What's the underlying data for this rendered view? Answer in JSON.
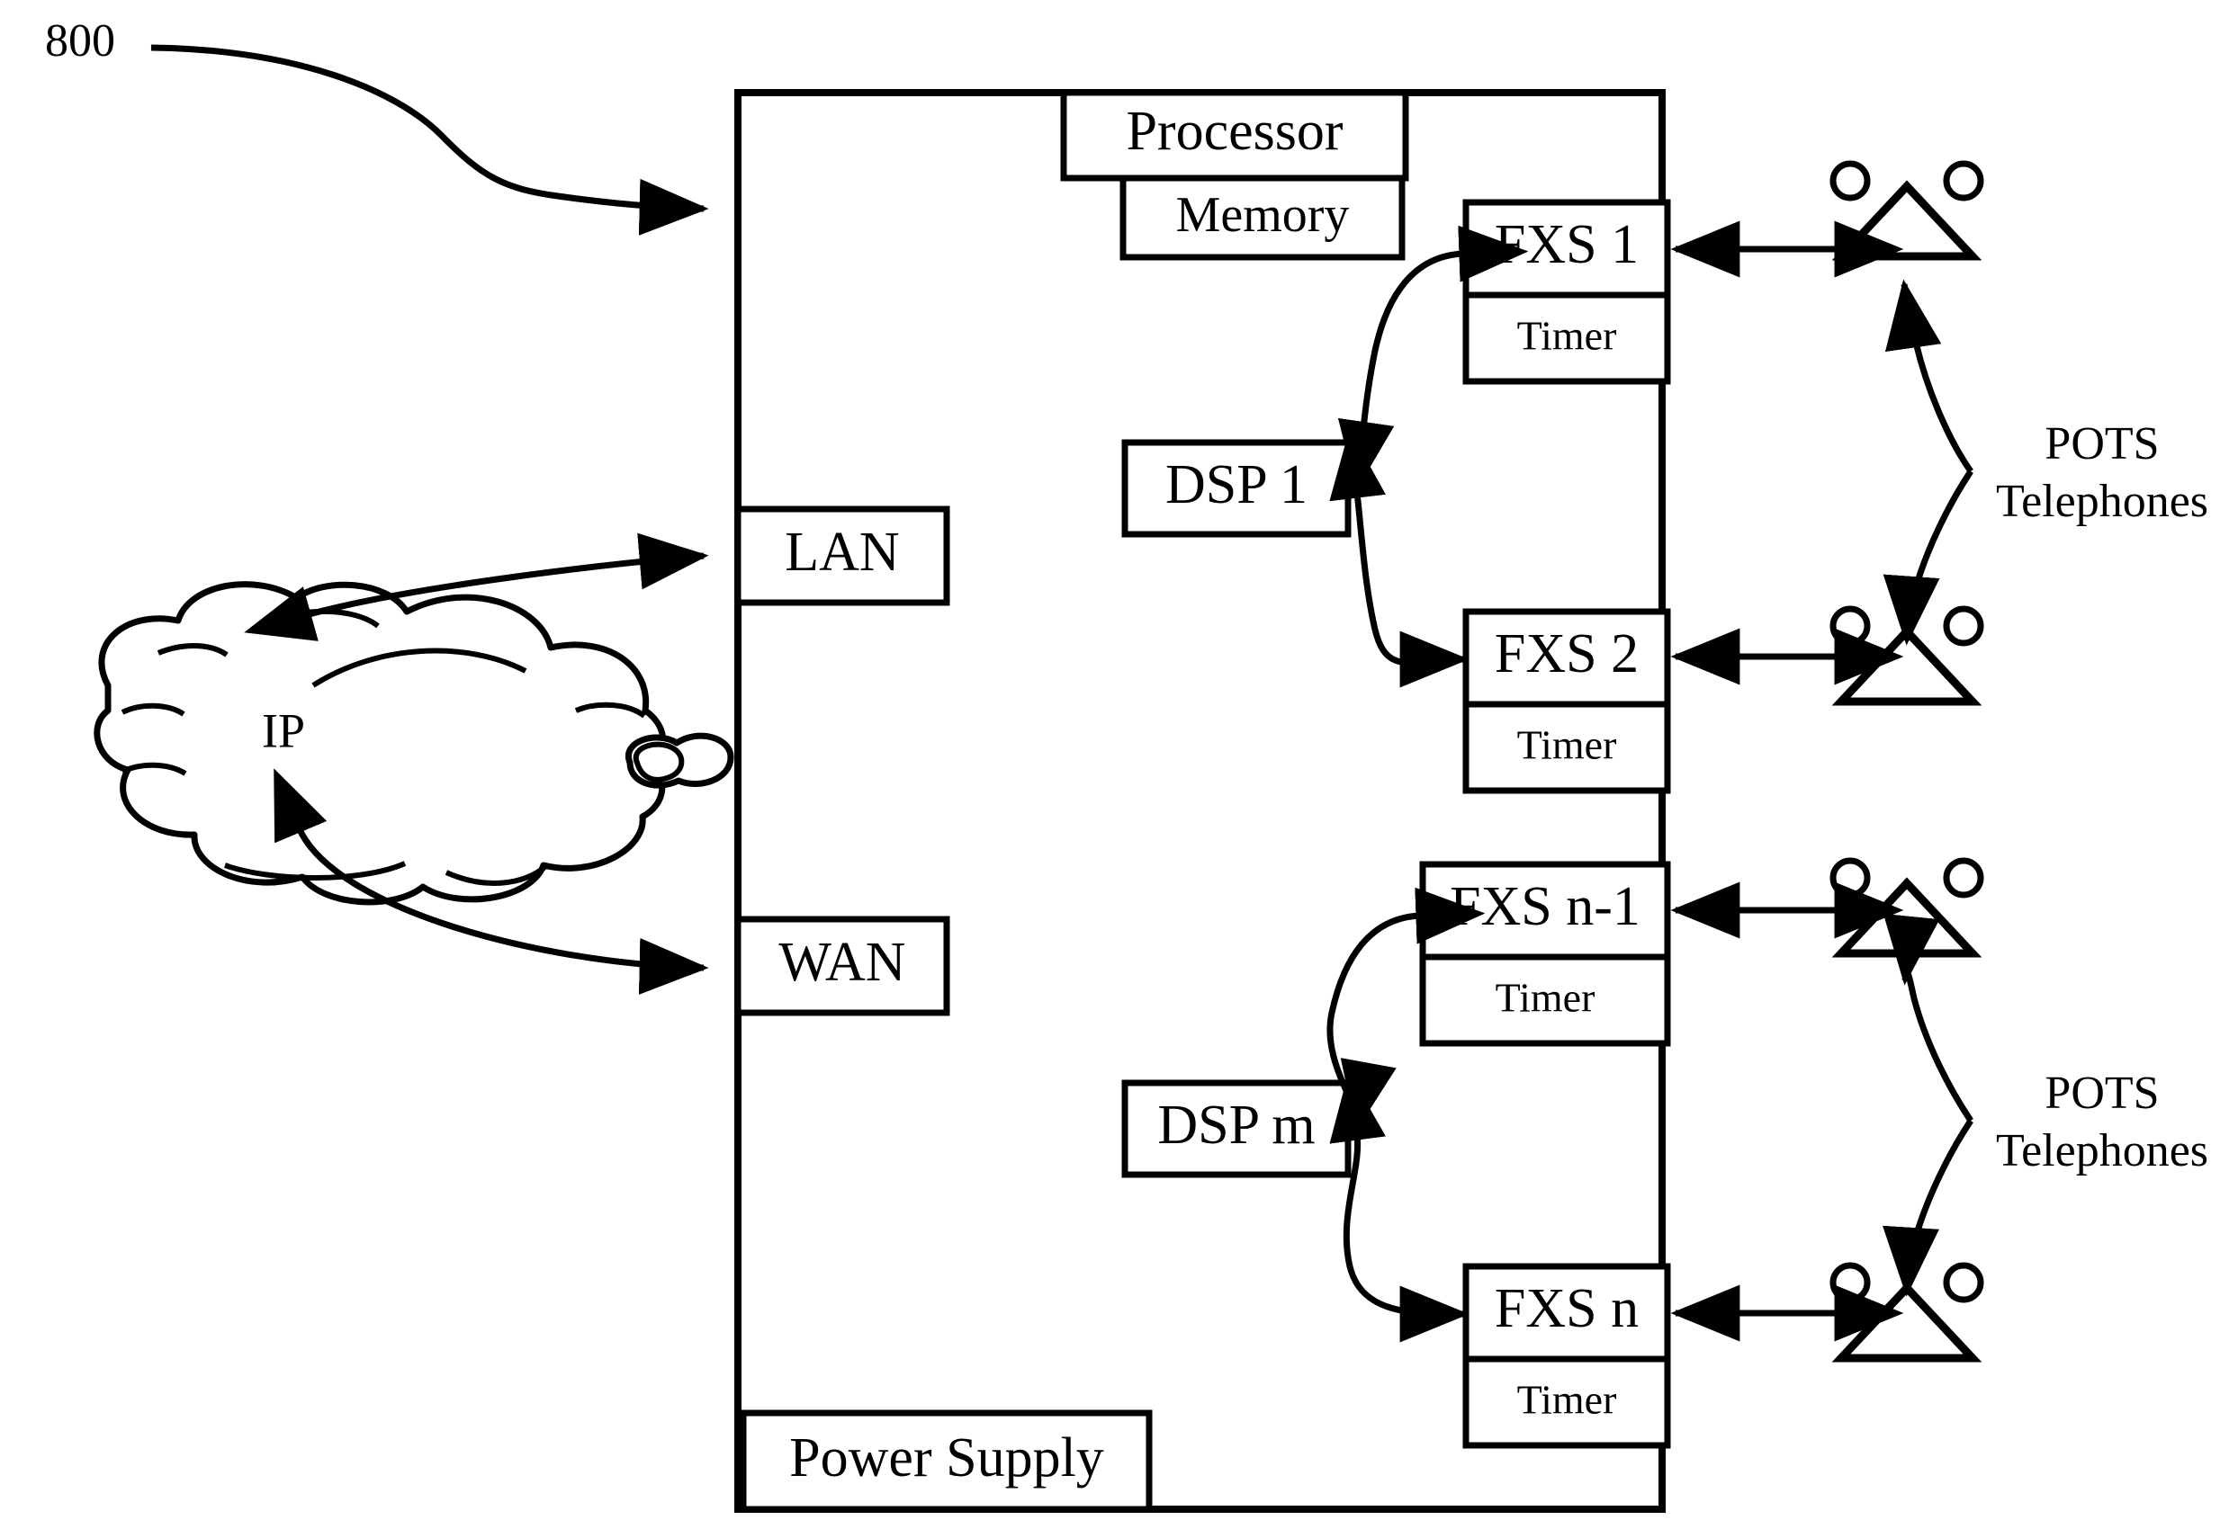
{
  "figure": {
    "reference_numeral": "800"
  },
  "network": {
    "cloud_label": "IP"
  },
  "device": {
    "processor_label": "Processor",
    "memory_label": "Memory",
    "power_supply_label": "Power Supply",
    "interfaces": [
      {
        "label": "LAN"
      },
      {
        "label": "WAN"
      }
    ],
    "dsps": [
      {
        "label": "DSP 1"
      },
      {
        "label": "DSP m"
      }
    ],
    "fxs_ports": [
      {
        "label": "FXS 1",
        "timer_label": "Timer"
      },
      {
        "label": "FXS 2",
        "timer_label": "Timer"
      },
      {
        "label": "FXS n-1",
        "timer_label": "Timer"
      },
      {
        "label": "FXS n",
        "timer_label": "Timer"
      }
    ]
  },
  "endpoints": {
    "groups": [
      {
        "line1": "POTS",
        "line2": "Telephones"
      },
      {
        "line1": "POTS",
        "line2": "Telephones"
      }
    ]
  },
  "colors": {
    "ink": "#000000",
    "paper": "#ffffff"
  }
}
